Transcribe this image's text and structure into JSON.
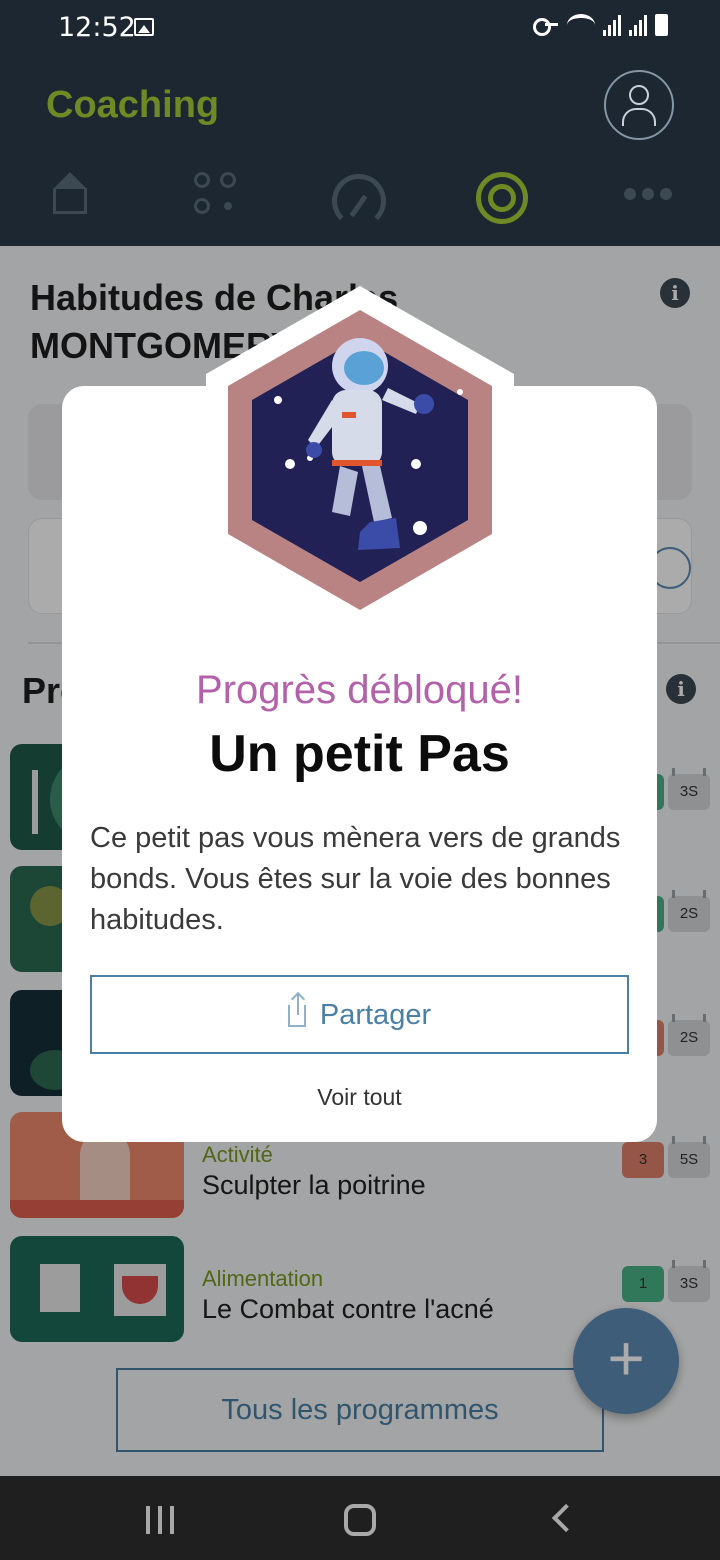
{
  "status": {
    "time": "12:52"
  },
  "header": {
    "title": "Coaching"
  },
  "habits": {
    "title": "Habitudes de Charles MONTGOMERY-JONAS"
  },
  "programs": {
    "title": "Programmes",
    "items": [
      {
        "category": "",
        "name": "",
        "level": "",
        "weeks": "3S",
        "color": "#2e8b6d"
      },
      {
        "category": "",
        "name": "",
        "level": "",
        "weeks": "2S",
        "color": "#2e8b6d"
      },
      {
        "category": "",
        "name": "",
        "level": "",
        "weeks": "2S",
        "color": "#d06a4a"
      },
      {
        "category": "Activité",
        "name": "Sculpter la poitrine",
        "level": "3",
        "weeks": "5S",
        "color": "#e0806a"
      },
      {
        "category": "Alimentation",
        "name": "Le Combat contre l'acné",
        "level": "1",
        "weeks": "3S",
        "color": "#49b487"
      }
    ],
    "all_button": "Tous les programmes"
  },
  "modal": {
    "subtitle": "Progrès débloqué!",
    "title": "Un petit Pas",
    "description": "Ce petit pas vous mènera vers de grands bonds. Vous êtes sur la voie des bonnes habitudes.",
    "share_label": "Partager",
    "view_all_label": "Voir tout",
    "badge_icon": "astronaut-hexagon-badge"
  },
  "colors": {
    "header_bg": "#1c2731",
    "accent_green": "#6f8a25",
    "accent_blue": "#4b7fa4",
    "subtitle_purple": "#b361a8"
  }
}
